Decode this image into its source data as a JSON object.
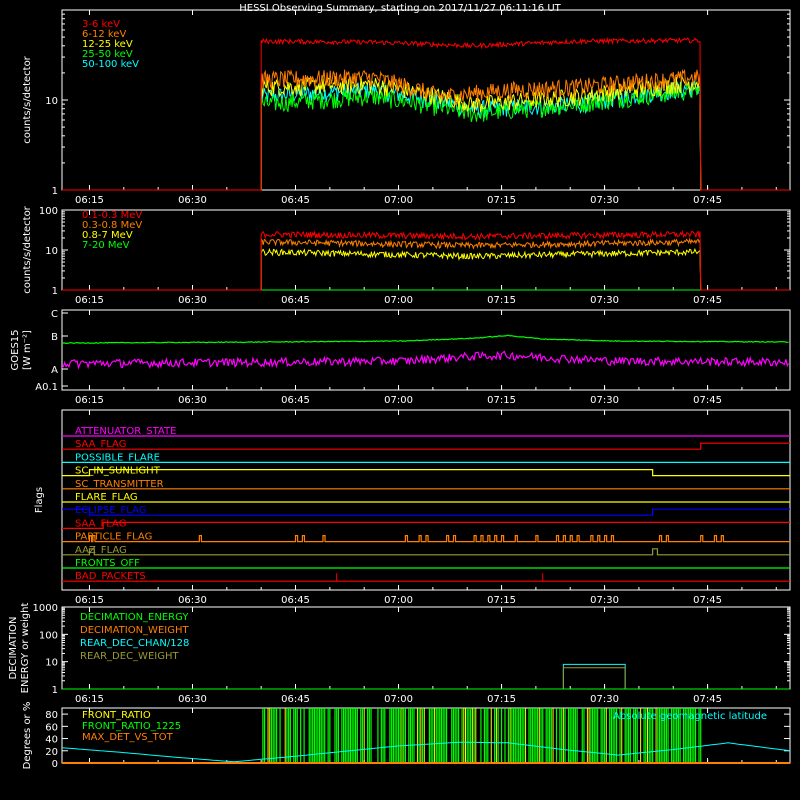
{
  "title": "HESSI Observing Summary, starting on 2017/11/27 06:11:16 UT",
  "time_axis": {
    "range_min": [
      0,
      106
    ],
    "tick_labels": [
      "06:15",
      "06:30",
      "06:45",
      "07:00",
      "07:15",
      "07:30",
      "07:45"
    ],
    "tick_minutes": [
      4,
      19,
      34,
      49,
      64,
      79,
      94
    ]
  },
  "panels": [
    {
      "id": "low-energy",
      "ylabel": "counts/s/detector",
      "ylog": true,
      "yticks": [
        "1",
        "10"
      ],
      "yticks_val": [
        1,
        10
      ],
      "ylim": [
        1,
        100
      ],
      "legend": [
        {
          "name": "3-6 keV",
          "color": "#ff0000"
        },
        {
          "name": "6-12 keV",
          "color": "#ff7f00"
        },
        {
          "name": "12-25 keV",
          "color": "#ffff00"
        },
        {
          "name": "25-50 keV",
          "color": "#00ff00"
        },
        {
          "name": "50-100 keV",
          "color": "#00ffff"
        }
      ]
    },
    {
      "id": "high-energy",
      "ylabel": "counts/s/detector",
      "ylog": true,
      "yticks": [
        "1",
        "10",
        "100"
      ],
      "yticks_val": [
        1,
        10,
        100
      ],
      "ylim": [
        1,
        100
      ],
      "legend": [
        {
          "name": "0.1-0.3 MeV",
          "color": "#ff0000"
        },
        {
          "name": "0.3-0.8 MeV",
          "color": "#ff7f00"
        },
        {
          "name": "0.8-7 MeV",
          "color": "#ffff00"
        },
        {
          "name": "7-20 MeV",
          "color": "#00ff00"
        }
      ]
    },
    {
      "id": "goes",
      "ylabel": "GOES15",
      "ylabel2": "[W m⁻²]",
      "yticks": [
        "A0.1",
        "A",
        "B",
        "C"
      ]
    },
    {
      "id": "flags",
      "ylabel": "Flags",
      "flags": [
        {
          "name": "ATTENUATOR_STATE",
          "color": "#ff00ff"
        },
        {
          "name": "SAA_FLAG ",
          "color": "#ff0000"
        },
        {
          "name": "POSSIBLE_FLARE",
          "color": "#00ffff"
        },
        {
          "name": "SC_IN_SUNLIGHT",
          "color": "#ffff00"
        },
        {
          "name": "SC_TRANSMITTER",
          "color": "#ff7f00"
        },
        {
          "name": "FLARE_FLAG",
          "color": "#ffff00"
        },
        {
          "name": "ECLIPSE_FLAG",
          "color": "#0000ff"
        },
        {
          "name": "SAA_FLAG",
          "color": "#ff0000"
        },
        {
          "name": "PARTICLE_FLAG",
          "color": "#ff7f00"
        },
        {
          "name": "AAZ_FLAG",
          "color": "#999933"
        },
        {
          "name": "FRONTS_OFF",
          "color": "#00ff00"
        },
        {
          "name": "BAD_PACKETS",
          "color": "#ff0000"
        }
      ]
    },
    {
      "id": "decimation",
      "ylabel": "DECIMATION",
      "ylabel2": "ENERGY or weight",
      "ylog": true,
      "yticks": [
        "1",
        "10",
        "100",
        "1000"
      ],
      "yticks_val": [
        1,
        10,
        100,
        1000
      ],
      "ylim": [
        1,
        1000
      ],
      "legend": [
        {
          "name": "DECIMATION_ENERGY",
          "color": "#00ff00"
        },
        {
          "name": "DECIMATION_WEIGHT",
          "color": "#ff7f00"
        },
        {
          "name": "REAR_DEC_CHAN/128",
          "color": "#00ffff"
        },
        {
          "name": "REAR_DEC_WEIGHT",
          "color": "#999933"
        }
      ]
    },
    {
      "id": "ratios",
      "ylabel": "Degrees or %",
      "yticks": [
        "0",
        "20",
        "40",
        "60",
        "80"
      ],
      "yticks_val": [
        0,
        20,
        40,
        60,
        80
      ],
      "ylim": [
        0,
        90
      ],
      "legend": [
        {
          "name": "FRONT_RATIO",
          "color": "#ffff00"
        },
        {
          "name": "FRONT_RATIO_1225",
          "color": "#00ff00"
        },
        {
          "name": "MAX_DET_VS_TOT",
          "color": "#ff7f00"
        }
      ],
      "note": {
        "text": "Absolute geomagnetic latitude",
        "color": "#00ffff"
      }
    }
  ],
  "chart_data": [
    {
      "type": "line",
      "title": "HESSI Observing Summary, starting on 2017/11/27 06:11:16 UT",
      "ylabel": "counts/s/detector",
      "yscale": "log",
      "ylim": [
        1,
        100
      ],
      "x_units": "minutes after 06:11:16 UT",
      "data_window": [
        29,
        93
      ],
      "series": [
        {
          "name": "3-6 keV",
          "color": "#ff0000",
          "x": [
            29,
            45,
            60,
            75,
            93
          ],
          "values": [
            45,
            44,
            40,
            45,
            46
          ]
        },
        {
          "name": "6-12 keV",
          "color": "#ff7f00",
          "x": [
            29,
            45,
            55,
            65,
            75,
            93
          ],
          "values": [
            17,
            18,
            11,
            13,
            14,
            18
          ]
        },
        {
          "name": "12-25 keV",
          "color": "#ffff00",
          "x": [
            29,
            45,
            60,
            75,
            93
          ],
          "values": [
            14,
            15,
            9,
            11,
            16
          ]
        },
        {
          "name": "25-50 keV",
          "color": "#00ff00",
          "x": [
            29,
            45,
            60,
            75,
            93
          ],
          "values": [
            9,
            11,
            7,
            9,
            13
          ]
        },
        {
          "name": "50-100 keV",
          "color": "#00ffff",
          "x": [
            29,
            45,
            60,
            75,
            93
          ],
          "values": [
            11,
            13,
            8,
            9,
            14
          ]
        }
      ]
    },
    {
      "type": "line",
      "ylabel": "counts/s/detector",
      "yscale": "log",
      "ylim": [
        1,
        100
      ],
      "data_window": [
        29,
        93
      ],
      "series": [
        {
          "name": "0.1-0.3 MeV",
          "color": "#ff0000",
          "x": [
            29,
            60,
            93
          ],
          "values": [
            25,
            22,
            25
          ]
        },
        {
          "name": "0.3-0.8 MeV",
          "color": "#ff7f00",
          "x": [
            29,
            60,
            93
          ],
          "values": [
            16,
            13,
            16
          ]
        },
        {
          "name": "0.8-7 MeV",
          "color": "#ffff00",
          "x": [
            29,
            60,
            93
          ],
          "values": [
            9,
            7,
            9
          ]
        },
        {
          "name": "7-20 MeV",
          "color": "#00ff00",
          "x": [
            0,
            106
          ],
          "values": [
            1,
            1
          ]
        }
      ]
    },
    {
      "type": "line",
      "ylabel": "GOES15",
      "series": [
        {
          "color": "#00ff00",
          "x": [
            0,
            30,
            50,
            60,
            65,
            70,
            80,
            106
          ],
          "values": [
            1.2e-07,
            1.25e-07,
            1.3e-07,
            1.45e-07,
            1.6e-07,
            1.4e-07,
            1.3e-07,
            1.25e-07
          ]
        },
        {
          "color": "#ff00ff",
          "x": [
            0,
            30,
            50,
            60,
            65,
            70,
            80,
            106
          ],
          "values": [
            1.7e-08,
            1.8e-08,
            1.9e-08,
            2.3e-08,
            2.4e-08,
            2.2e-08,
            1.9e-08,
            1.8e-08
          ]
        }
      ]
    },
    {
      "type": "line",
      "ylabel": "Flags",
      "series_states": {
        "SAA_FLAG ": [
          [
            0,
            0
          ],
          [
            93,
            1
          ]
        ],
        "SC_IN_SUNLIGHT": [
          [
            0,
            0
          ],
          [
            4,
            1
          ],
          [
            86,
            0
          ]
        ],
        "ECLIPSE_FLAG": [
          [
            0,
            1
          ],
          [
            4,
            0
          ],
          [
            86,
            1
          ]
        ],
        "SAA_FLAG": [
          [
            0,
            0
          ],
          [
            6,
            1
          ]
        ],
        "AAZ_FLAG": [
          [
            0,
            0
          ],
          [
            4,
            1
          ],
          [
            4.7,
            0
          ],
          [
            86,
            1
          ],
          [
            86.7,
            0
          ]
        ],
        "BAD_PACKETS_spikes": [
          40,
          70
        ]
      }
    },
    {
      "type": "line",
      "ylabel": "DECIMATION",
      "yscale": "log",
      "ylim": [
        1,
        1000
      ],
      "series": [
        {
          "name": "REAR_DEC_CHAN/128",
          "color": "#00ffff",
          "x": [
            73,
            73,
            82,
            82
          ],
          "values": [
            1,
            8,
            8,
            1
          ]
        },
        {
          "name": "REAR_DEC_WEIGHT",
          "color": "#999933",
          "x": [
            73,
            73,
            82,
            82
          ],
          "values": [
            1,
            6,
            6,
            1
          ]
        }
      ]
    },
    {
      "type": "line",
      "ylabel": "Degrees or %",
      "ylim": [
        0,
        90
      ],
      "series": [
        {
          "name": "Absolute geomagnetic latitude",
          "color": "#00ffff",
          "x": [
            0,
            8,
            17,
            25,
            33,
            41,
            49,
            58,
            65,
            73,
            81,
            89,
            97,
            106
          ],
          "values": [
            25,
            18,
            9,
            2,
            10,
            19,
            28,
            34,
            33,
            22,
            13,
            22,
            33,
            20
          ]
        }
      ]
    }
  ]
}
